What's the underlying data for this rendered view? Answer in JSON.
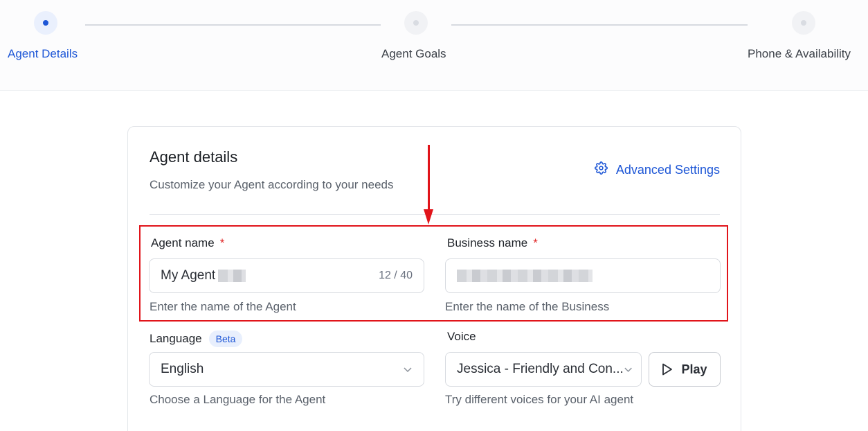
{
  "stepper": {
    "steps": [
      {
        "label": "Agent Details",
        "active": true
      },
      {
        "label": "Agent Goals",
        "active": false
      },
      {
        "label": "Phone & Availability",
        "active": false
      }
    ]
  },
  "card": {
    "title": "Agent details",
    "subtitle": "Customize your Agent according to your needs",
    "advanced_settings": {
      "label": "Advanced Settings",
      "icon": "gear-icon"
    }
  },
  "agent_name": {
    "label": "Agent name",
    "required": "*",
    "value": "My Agent",
    "counter": "12 / 40",
    "helper": "Enter the name of the Agent"
  },
  "business_name": {
    "label": "Business name",
    "required": "*",
    "value": "",
    "helper": "Enter the name of the Business"
  },
  "language": {
    "label": "Language",
    "badge": "Beta",
    "selected": "English",
    "helper": "Choose a Language for the Agent"
  },
  "voice": {
    "label": "Voice",
    "selected": "Jessica - Friendly and Con...",
    "play_label": "Play",
    "helper": "Try different voices for your AI agent"
  },
  "colors": {
    "accent": "#1d56d6",
    "required": "#e02424",
    "annotation": "#e1141a"
  }
}
